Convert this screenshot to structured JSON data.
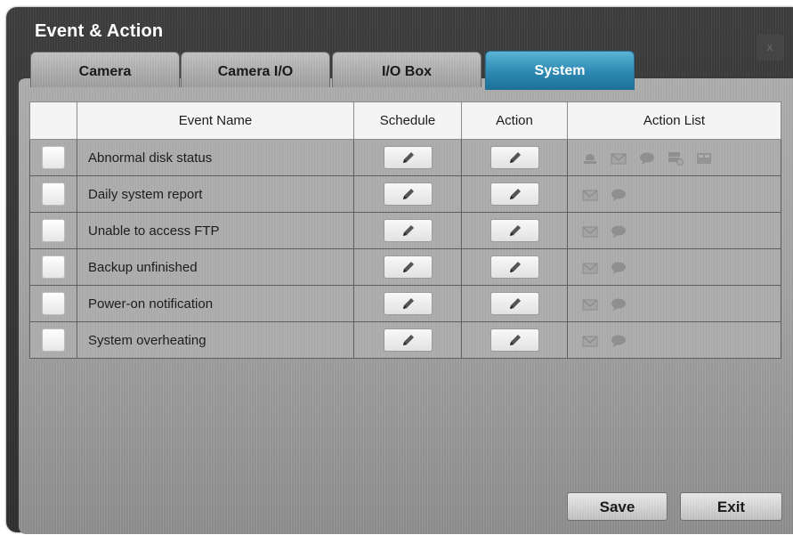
{
  "window": {
    "title": "Event & Action",
    "close_label": "x"
  },
  "tabs": [
    {
      "label": "Camera",
      "active": false
    },
    {
      "label": "Camera I/O",
      "active": false
    },
    {
      "label": "I/O Box",
      "active": false
    },
    {
      "label": "System",
      "active": true
    }
  ],
  "table": {
    "headers": {
      "check": "",
      "event_name": "Event Name",
      "schedule": "Schedule",
      "action": "Action",
      "action_list": "Action List"
    },
    "rows": [
      {
        "name": "Abnormal disk status",
        "actions": [
          "alarm-icon",
          "mail-icon",
          "chat-icon",
          "server-icon",
          "panel-icon"
        ]
      },
      {
        "name": "Daily system report",
        "actions": [
          "mail-icon",
          "chat-icon"
        ]
      },
      {
        "name": "Unable to access FTP",
        "actions": [
          "mail-icon",
          "chat-icon"
        ]
      },
      {
        "name": "Backup unfinished",
        "actions": [
          "mail-icon",
          "chat-icon"
        ]
      },
      {
        "name": "Power-on notification",
        "actions": [
          "mail-icon",
          "chat-icon"
        ]
      },
      {
        "name": "System overheating",
        "actions": [
          "mail-icon",
          "chat-icon"
        ]
      }
    ]
  },
  "buttons": {
    "save_label": "Save",
    "exit_label": "Exit"
  },
  "colors": {
    "active_tab": "#2c88b1",
    "panel": "#a5a5a5",
    "window": "#333333"
  }
}
